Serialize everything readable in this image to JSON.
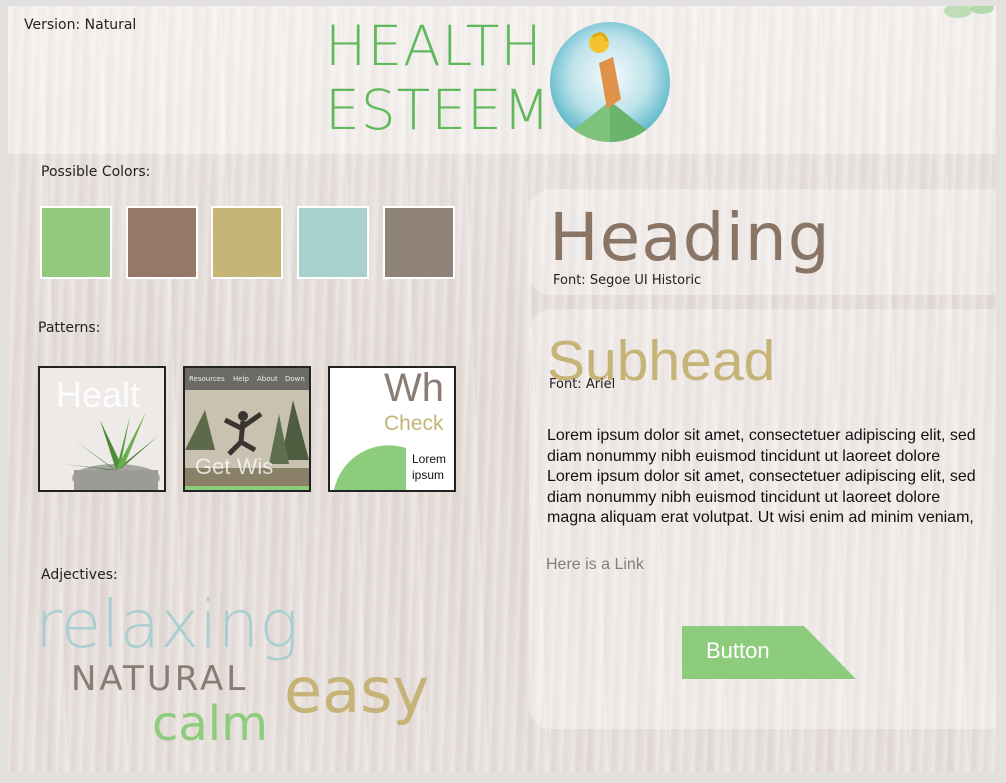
{
  "header": {
    "version": "Version: Natural",
    "brand_line1": "HEALTH",
    "brand_line2": "ESTEEM"
  },
  "colors": {
    "label": "Possible Colors:",
    "swatches": [
      "#93c97e",
      "#957967",
      "#c5b574",
      "#a8d0cf",
      "#8e8279"
    ]
  },
  "patterns": {
    "label": "Patterns:",
    "p1_text": "Healt",
    "p2_nav": [
      "Resources",
      "Help",
      "About",
      "Down"
    ],
    "p2_overlay": "Get Wis",
    "p3_big": "Wh",
    "p3_check": "Check",
    "p3_lorem1": "Lorem",
    "p3_lorem2": "ipsum"
  },
  "adjectives": {
    "label": "Adjectives:",
    "words": [
      "relaxing",
      "NATURAL",
      "easy",
      "calm"
    ]
  },
  "typography": {
    "heading": "Heading",
    "heading_font": "Font: Segoe UI Historic",
    "subhead": "Subhead",
    "subhead_font": "Font: Ariel",
    "body": "Lorem ipsum dolor sit amet, consectetuer adipiscing elit, sed diam nonummy nibh euismod tincidunt ut laoreet dolore Lorem ipsum dolor sit amet, consectetuer adipiscing elit, sed diam nonummy nibh euismod tincidunt ut laoreet dolore magna aliquam erat volutpat. Ut wisi enim ad minim veniam,",
    "link": "Here is a Link",
    "button": "Button"
  }
}
